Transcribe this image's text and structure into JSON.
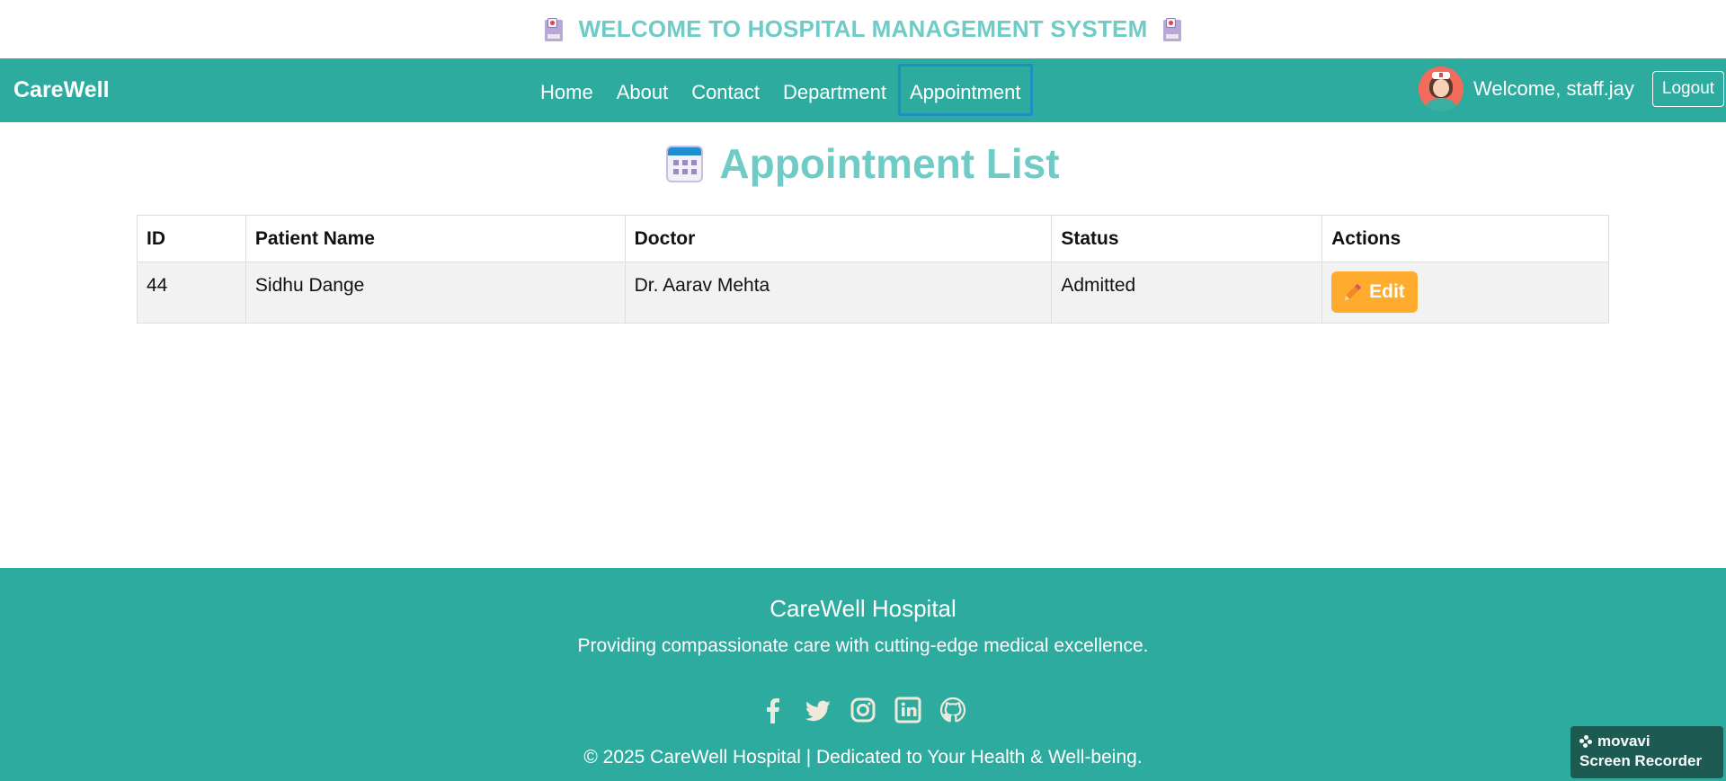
{
  "banner": {
    "text": "WELCOME TO HOSPITAL MANAGEMENT SYSTEM",
    "icon": "hospital-icon"
  },
  "navbar": {
    "brand": "CareWell",
    "links": [
      {
        "label": "Home"
      },
      {
        "label": "About"
      },
      {
        "label": "Contact"
      },
      {
        "label": "Department"
      },
      {
        "label": "Appointment",
        "active": true
      }
    ],
    "welcome": "Welcome, staff.jay",
    "logout": "Logout",
    "color": "#2eab9f"
  },
  "page": {
    "title": "Appointment List",
    "title_icon": "calendar-icon",
    "title_color": "#6fcbc6"
  },
  "table": {
    "headers": [
      "ID",
      "Patient Name",
      "Doctor",
      "Status",
      "Actions"
    ],
    "rows": [
      {
        "id": "44",
        "patient": "Sidhu Dange",
        "doctor": "Dr. Aarav Mehta",
        "status": "Admitted",
        "action": "Edit"
      }
    ],
    "edit_color": "#ffac2e"
  },
  "footer": {
    "title": "CareWell Hospital",
    "tagline": "Providing compassionate care with cutting-edge medical excellence.",
    "socials": [
      "facebook-icon",
      "twitter-icon",
      "instagram-icon",
      "linkedin-icon",
      "github-icon"
    ],
    "copyright": "© 2025 CareWell Hospital | Dedicated to Your Health & Well-being."
  },
  "watermark": {
    "brand": "movavi",
    "product": "Screen Recorder"
  }
}
